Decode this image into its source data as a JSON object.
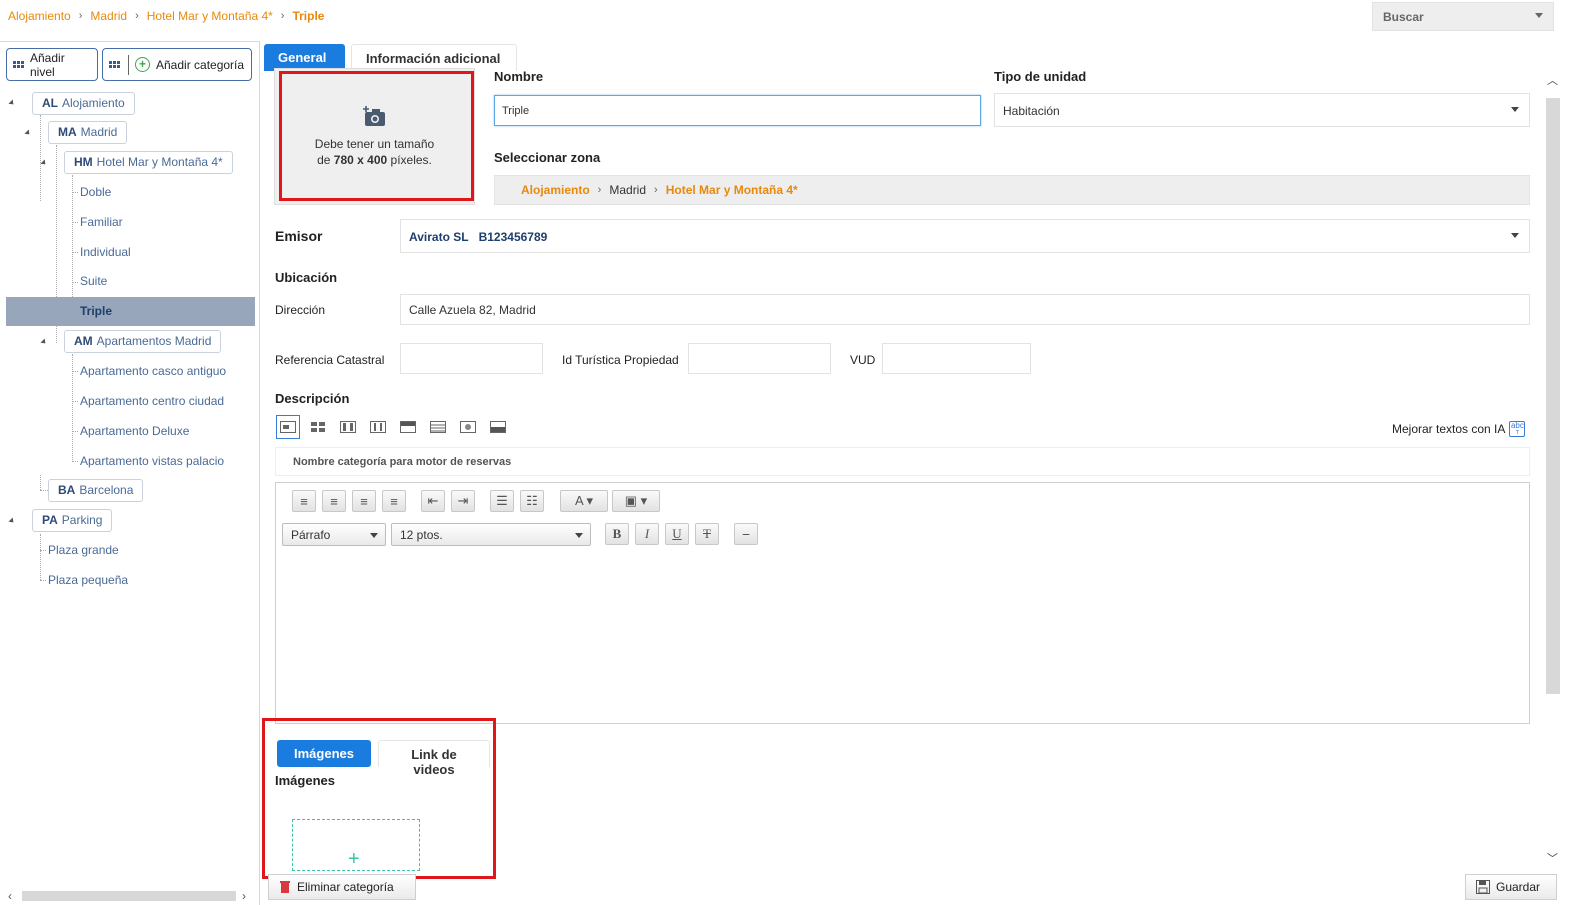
{
  "breadcrumb": {
    "items": [
      "Alojamiento",
      "Madrid",
      "Hotel Mar y Montaña 4*"
    ],
    "current": "Triple"
  },
  "search": {
    "placeholder": "Buscar"
  },
  "sidebar": {
    "add_level_label": "Añadir nivel",
    "add_category_label": "Añadir categoría",
    "tree": {
      "al": {
        "code": "AL",
        "label": "Alojamiento"
      },
      "ma": {
        "code": "MA",
        "label": "Madrid"
      },
      "hm": {
        "code": "HM",
        "label": "Hotel Mar y Montaña 4*"
      },
      "hm_items": [
        "Doble",
        "Familiar",
        "Individual",
        "Suite",
        "Triple"
      ],
      "am": {
        "code": "AM",
        "label": "Apartamentos Madrid"
      },
      "am_items": [
        "Apartamento casco antiguo",
        "Apartamento centro ciudad",
        "Apartamento Deluxe",
        "Apartamento vistas palacio"
      ],
      "ba": {
        "code": "BA",
        "label": "Barcelona"
      },
      "pa": {
        "code": "PA",
        "label": "Parking"
      },
      "pa_items": [
        "Plaza grande",
        "Plaza pequeña"
      ],
      "selected": "Triple"
    }
  },
  "tabs": {
    "general": "General",
    "additional": "Información adicional"
  },
  "photo": {
    "line1": "Debe tener un tamaño",
    "line2_prefix": "de ",
    "line2_bold": "780 x 400",
    "line2_suffix": " píxeles."
  },
  "form": {
    "name_label": "Nombre",
    "name_value": "Triple",
    "unit_type_label": "Tipo de unidad",
    "unit_type_value": "Habitación",
    "zone_label": "Seleccionar zona",
    "zone_path": [
      "Alojamiento",
      "Madrid",
      "Hotel Mar y Montaña 4*"
    ],
    "issuer_label": "Emisor",
    "issuer_name": "Avirato SL",
    "issuer_id": "B123456789",
    "location_label": "Ubicación",
    "address_label": "Dirección",
    "address_value": "Calle Azuela 82, Madrid",
    "cadastral_label": "Referencia Catastral",
    "cadastral_value": "",
    "tourist_id_label": "Id Turística Propiedad",
    "tourist_id_value": "",
    "vud_label": "VUD",
    "vud_value": "",
    "description_label": "Descripción",
    "ai_improve_label": "Mejorar textos con IA",
    "category_name_placeholder": "Nombre categoría para motor de reservas"
  },
  "editor": {
    "paragraph_value": "Párrafo",
    "size_value": "12 ptos."
  },
  "media": {
    "tab_images": "Imágenes",
    "tab_videos": "Link de videos",
    "images_label": "Imágenes"
  },
  "actions": {
    "delete_category": "Eliminar categoría",
    "save": "Guardar"
  },
  "colors": {
    "accent": "#1b7ce0",
    "orange": "#e8890c",
    "highlight_red": "#e0161b",
    "selection": "#97a6ba"
  }
}
